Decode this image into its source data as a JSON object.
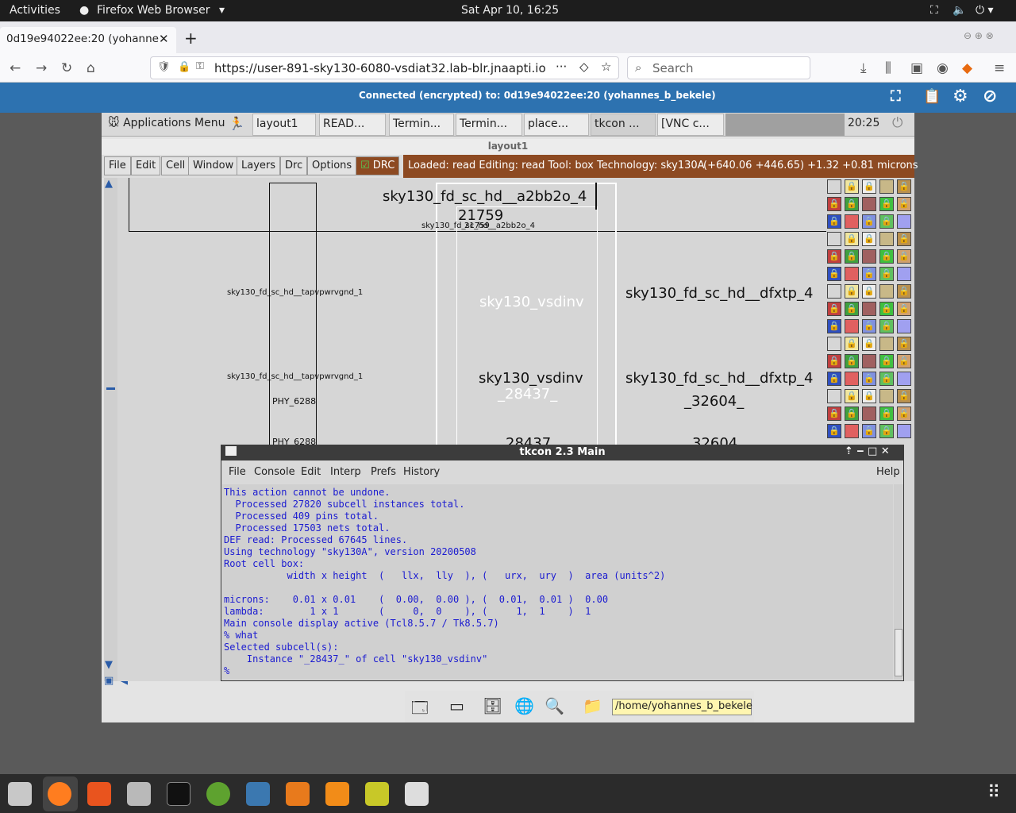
{
  "topbar": {
    "activities": "Activities",
    "app": "Firefox Web Browser",
    "clock": "Sat Apr 10, 16:25"
  },
  "browser": {
    "tab_title": "0d19e94022ee:20 (yohanne",
    "url": "https://user-891-sky130-6080-vsdiat32.lab-blr.jnaapti.io",
    "search_placeholder": "Search"
  },
  "vnc": {
    "status": "Connected (encrypted) to: 0d19e94022ee:20 (yohannes_b_bekele)"
  },
  "xfce": {
    "apps_menu": "Applications Menu",
    "tasks": [
      "layout1",
      "READ...",
      "Termin...",
      "Termin...",
      "place...",
      "tkcon ...",
      "[VNC c..."
    ],
    "clock": "20:25"
  },
  "magic": {
    "title": "layout1",
    "menu": [
      "File",
      "Edit",
      "Cell",
      "Window",
      "Layers",
      "Drc",
      "Options"
    ],
    "drc": "DRC",
    "status": "Loaded: read  Editing: read  Tool: box  Technology: sky130A",
    "coords": "(+640.06 +446.65) +1.32 +0.81 microns",
    "labels": {
      "a2bb2o": "sky130_fd_sc_hd__a2bb2o_4",
      "a2bb2o_id": "21759",
      "a2bb2o_small": "sky130_fd_sc_hd__a2bb2o_4",
      "a2bb2o_small_id": "21759",
      "tap1": "sky130_fd_sc_hd__tapvpwrvgnd_1",
      "tap2": "sky130_fd_sc_hd__tapvpwrvgnd_1",
      "phy1": "PHY_6288",
      "phy2": "PHY_6288",
      "vsdinv1": "sky130_vsdinv",
      "vsdinv2": "sky130_vsdinv",
      "vsdinv2_id": "_28437_",
      "vsdinv3_id": "28437",
      "dfxtp1": "sky130_fd_sc_hd__dfxtp_4",
      "dfxtp2": "sky130_fd_sc_hd__dfxtp_4",
      "dfxtp2_id": "_32604_",
      "dfxtp3_id": "32604"
    }
  },
  "tkcon": {
    "title": "tkcon 2.3 Main",
    "menu": [
      "File",
      "Console",
      "Edit",
      "Interp",
      "Prefs",
      "History"
    ],
    "help": "Help",
    "console": "This action cannot be undone.\n  Processed 27820 subcell instances total.\n  Processed 409 pins total.\n  Processed 17503 nets total.\nDEF read: Processed 67645 lines.\nUsing technology \"sky130A\", version 20200508\nRoot cell box:\n           width x height  (   llx,  lly  ), (   urx,  ury  )  area (units^2)\n\nmicrons:    0.01 x 0.01    (  0.00,  0.00 ), (  0.01,  0.01 )  0.00\nlambda:        1 x 1       (     0,  0    ), (     1,  1    )  1\nMain console display active (Tcl8.5.7 / Tk8.5.7)\n% what\nSelected subcell(s):\n    Instance \"_28437_\" of cell \"sky130_vsdinv\"\n%"
  },
  "xfce_bottom": {
    "path": "/home/yohannes_b_bekele"
  },
  "colors": {
    "vnc_blue": "#2d72b0",
    "magic_status": "#8d4a22",
    "console_text": "#1a1ad0"
  }
}
